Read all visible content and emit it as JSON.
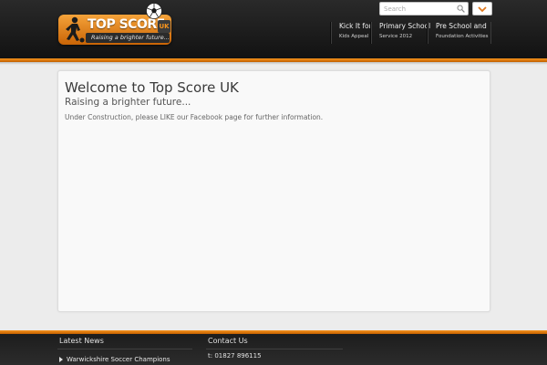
{
  "header": {
    "logo": {
      "title": "TOP SCORE",
      "badge": "UK",
      "tagline": "Raising a brighter future..."
    },
    "search": {
      "placeholder": "Search",
      "icon": "search-icon"
    },
    "dropdown_icon": "chevron-down-icon",
    "nav": [
      {
        "label": "Kick It for",
        "sub": "Kids Appeal"
      },
      {
        "label": "Primary School",
        "sub": "Service 2012"
      },
      {
        "label": "Pre School and",
        "sub": "Foundation Activities"
      }
    ]
  },
  "main": {
    "title": "Welcome to Top Score UK",
    "subtitle": "Raising a brighter future...",
    "text": "Under Construction, please LIKE our Facebook page for further information."
  },
  "footer": {
    "news_heading": "Latest News",
    "news_items": [
      "Warwickshire Soccer Champions"
    ],
    "contact_heading": "Contact Us",
    "contact_phone": "t: 01827 896115"
  },
  "colors": {
    "accent": "#f7941d",
    "header_bg": "#1a1a1a",
    "page_bg": "#ececec"
  }
}
